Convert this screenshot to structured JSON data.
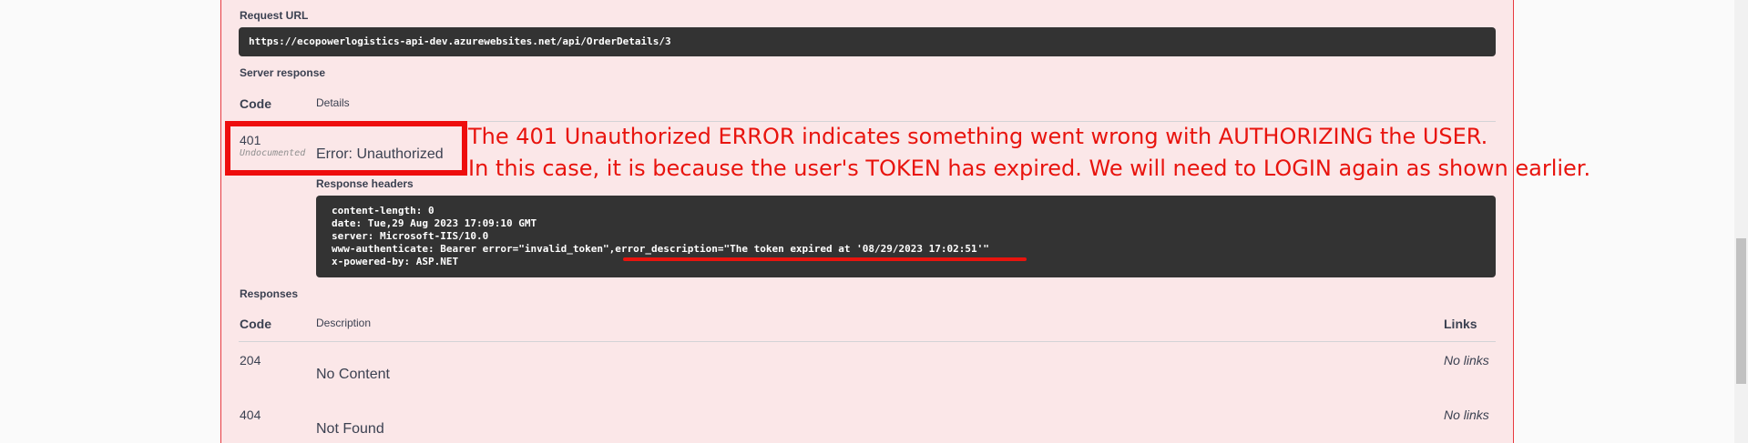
{
  "request": {
    "label": "Request URL",
    "url": "https://ecopowerlogistics-api-dev.azurewebsites.net/api/OrderDetails/3"
  },
  "server_response": {
    "label": "Server response",
    "col_code": "Code",
    "col_details": "Details",
    "code": "401",
    "undocumented": "Undocumented",
    "error_text": "Error: Unauthorized",
    "headers_label": "Response headers",
    "headers": [
      "content-length: 0",
      "date: Tue,29 Aug 2023 17:09:10 GMT",
      "server: Microsoft-IIS/10.0",
      "www-authenticate: Bearer error=\"invalid_token\",error_description=\"The token expired at '08/29/2023 17:02:51'\"",
      "x-powered-by: ASP.NET"
    ]
  },
  "responses": {
    "label": "Responses",
    "col_code": "Code",
    "col_description": "Description",
    "col_links": "Links",
    "rows": [
      {
        "code": "204",
        "description": "No Content",
        "links": "No links"
      },
      {
        "code": "404",
        "description": "Not Found",
        "links": "No links"
      }
    ]
  },
  "annotation": {
    "line1": "The 401 Unauthorized ERROR indicates something went wrong with AUTHORIZING the USER.",
    "line2": "In this case, it is because the user's TOKEN has expired. We will need to LOGIN again as shown earlier.",
    "color": "#e8140e"
  }
}
